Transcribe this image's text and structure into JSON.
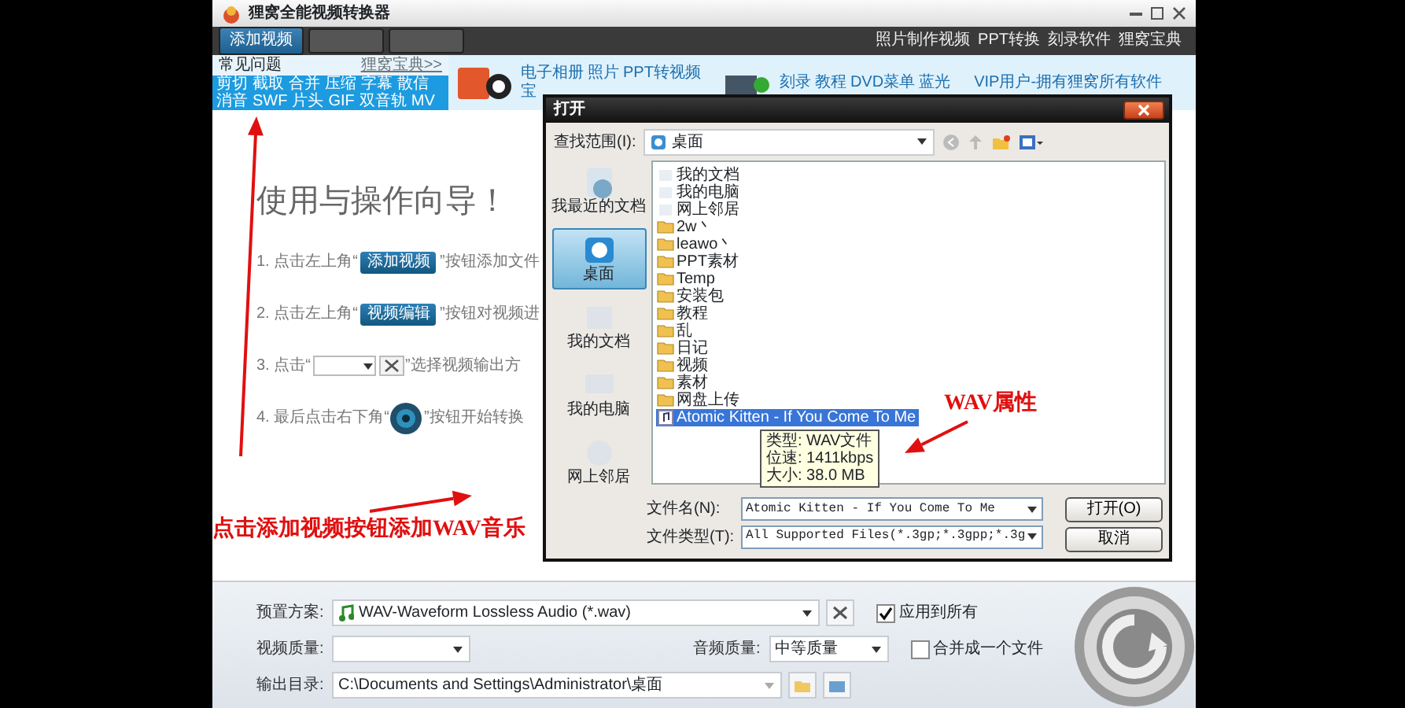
{
  "app": {
    "title": "狸窝全能视频转换器"
  },
  "toolbar": {
    "buttons": [
      {
        "label": "添加视频",
        "disabled": false
      },
      {
        "disabled": true
      },
      {
        "disabled": true
      }
    ],
    "links": [
      "照片制作视频",
      "PPT转换",
      "刻录软件",
      "狸窝宝典"
    ]
  },
  "faq": {
    "title": "常见问题",
    "more": "狸窝宝典>>",
    "rows": [
      [
        "剪切",
        "截取",
        "合并",
        "压缩",
        "字幕",
        "散信"
      ],
      [
        "消音",
        "SWF",
        "片头",
        "GIF",
        "双音轨",
        "MV"
      ]
    ]
  },
  "promos": [
    {
      "rows": [
        [
          "电子相册",
          "照片",
          "PPT转视频"
        ],
        [
          "宝"
        ]
      ]
    },
    {
      "rows": [
        [
          "刻录",
          "教程",
          "DVD菜单",
          "蓝光"
        ]
      ]
    },
    {
      "rows": [
        [
          "VIP用户-拥有狸窝所有软件"
        ]
      ]
    }
  ],
  "guide": {
    "title": "使用与操作向导！",
    "steps": [
      {
        "kind": "button",
        "prefix": "1. 点击左上角“",
        "button": "添加视频",
        "suffix": "”按钮添加文件"
      },
      {
        "kind": "button",
        "prefix": "2. 点击左上角“",
        "button": "视频编辑",
        "suffix": "”按钮对视频进"
      },
      {
        "kind": "combo",
        "prefix": "3. 点击“",
        "suffix": "”选择视频输出方"
      },
      {
        "kind": "round",
        "prefix": "4. 最后点击右下角“",
        "suffix": "”按钮开始转换"
      }
    ]
  },
  "dialog": {
    "title": "打开",
    "look_in_label": "查找范围(I):",
    "look_in": "桌面",
    "places": [
      {
        "label": "我最近的文档",
        "selected": false
      },
      {
        "label": "桌面",
        "selected": true
      },
      {
        "label": "我的文档",
        "selected": false
      },
      {
        "label": "我的电脑",
        "selected": false
      },
      {
        "label": "网上邻居",
        "selected": false
      }
    ],
    "files": [
      {
        "name": "我的文档",
        "kind": "system",
        "selected": false
      },
      {
        "name": "我的电脑",
        "kind": "system",
        "selected": false
      },
      {
        "name": "网上邻居",
        "kind": "system",
        "selected": false
      },
      {
        "name": "2w丶",
        "kind": "folder",
        "selected": false
      },
      {
        "name": "leawo丶",
        "kind": "folder",
        "selected": false
      },
      {
        "name": "PPT素材",
        "kind": "folder",
        "selected": false
      },
      {
        "name": "Temp",
        "kind": "folder",
        "selected": false
      },
      {
        "name": "安装包",
        "kind": "folder",
        "selected": false
      },
      {
        "name": "教程",
        "kind": "folder",
        "selected": false
      },
      {
        "name": "乱",
        "kind": "folder",
        "selected": false
      },
      {
        "name": "日记",
        "kind": "folder",
        "selected": false
      },
      {
        "name": "视频",
        "kind": "folder",
        "selected": false
      },
      {
        "name": "素材",
        "kind": "folder",
        "selected": false
      },
      {
        "name": "网盘上传",
        "kind": "folder",
        "selected": false
      },
      {
        "name": "Atomic Kitten - If You Come To Me",
        "kind": "audio",
        "selected": true
      }
    ],
    "tooltip": [
      "类型: WAV文件",
      "位速: 1411kbps",
      "大小: 38.0 MB"
    ],
    "filename_label": "文件名(N):",
    "filename": "Atomic Kitten - If You Come To Me",
    "filetype_label": "文件类型(T):",
    "filetype": "All Supported Files(*.3gp;*.3gpp;*.3g",
    "buttons": [
      "打开(O)",
      "取消"
    ]
  },
  "annotations": [
    {
      "text": "点击添加视频按钮添加WAV音乐"
    },
    {
      "text": "WAV属性"
    }
  ],
  "settings": {
    "preset_label": "预置方案:",
    "preset": "WAV-Waveform Lossless Audio (*.wav)",
    "apply_all": {
      "label": "应用到所有",
      "checked": true
    },
    "video_quality_label": "视频质量:",
    "audio_quality_label": "音频质量:",
    "audio_quality": "中等质量",
    "merge": {
      "label": "合并成一个文件",
      "checked": false
    },
    "output_label": "输出目录:",
    "output": "C:\\Documents and Settings\\Administrator\\桌面"
  }
}
